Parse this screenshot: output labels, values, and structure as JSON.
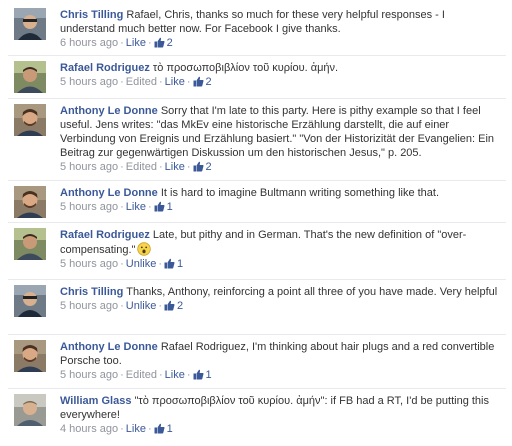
{
  "comments": [
    {
      "author": "Chris Tilling",
      "text": "Rafael, Chris, thanks so much for these very helpful responses - I understand much better now. For Facebook I give thanks.",
      "time": "6 hours ago",
      "like_label": "Like",
      "like_count": "2",
      "avatar_icon": "profile-photo-icon"
    },
    {
      "author": "Rafael Rodriguez",
      "text": "τὸ προσωποβιβλίον τοῦ κυρίου. ἀμήν.",
      "time": "5 hours ago",
      "edited": "Edited",
      "like_label": "Like",
      "like_count": "2",
      "avatar_icon": "profile-photo-icon"
    },
    {
      "author": "Anthony Le Donne",
      "text": "Sorry that I'm late to this party. Here is pithy example so that I feel useful. Jens writes: \"das MkEv eine historische Erzählung darstellt, die auf einer Verbindung von Ereignis und Erzählung basiert.\" \"Von der Historizität der Evangelien: Ein Beitrag zur gegenwärtigen Diskussion um den historischen Jesus,\" p. 205.",
      "time": "5 hours ago",
      "edited": "Edited",
      "like_label": "Like",
      "like_count": "2",
      "avatar_icon": "profile-photo-icon"
    },
    {
      "author": "Anthony Le Donne",
      "text": "It is hard to imagine Bultmann writing something like that.",
      "time": "5 hours ago",
      "like_label": "Like",
      "like_count": "1",
      "avatar_icon": "profile-photo-icon"
    },
    {
      "author": "Rafael Rodriguez",
      "text": "Late, but pithy and in German. That's the new definition of \"over-compensating.\"",
      "emoticon": "surprised-emoticon",
      "time": "5 hours ago",
      "like_label": "Unlike",
      "like_count": "1",
      "avatar_icon": "profile-photo-icon"
    },
    {
      "author": "Chris Tilling",
      "text": "Thanks, Anthony, reinforcing a point all three of you have made. Very helpful",
      "time": "5 hours ago",
      "like_label": "Unlike",
      "like_count": "2",
      "avatar_icon": "profile-photo-icon"
    },
    {
      "author": "Anthony Le Donne",
      "text": "Rafael Rodriguez, I'm thinking about hair plugs and a red convertible Porsche too.",
      "time": "5 hours ago",
      "edited": "Edited",
      "like_label": "Like",
      "like_count": "1",
      "avatar_icon": "profile-photo-icon"
    },
    {
      "author": "William Glass",
      "text": "\"τὸ προσωποβιβλίον τοῦ κυρίου. ἀμήν\": if FB had a RT, I'd be putting this everywhere!",
      "time": "4 hours ago",
      "like_label": "Like",
      "like_count": "1",
      "avatar_icon": "profile-photo-icon"
    }
  ],
  "colors": {
    "link": "#3b5998",
    "meta": "#90949c",
    "divider": "#e9eaed"
  }
}
